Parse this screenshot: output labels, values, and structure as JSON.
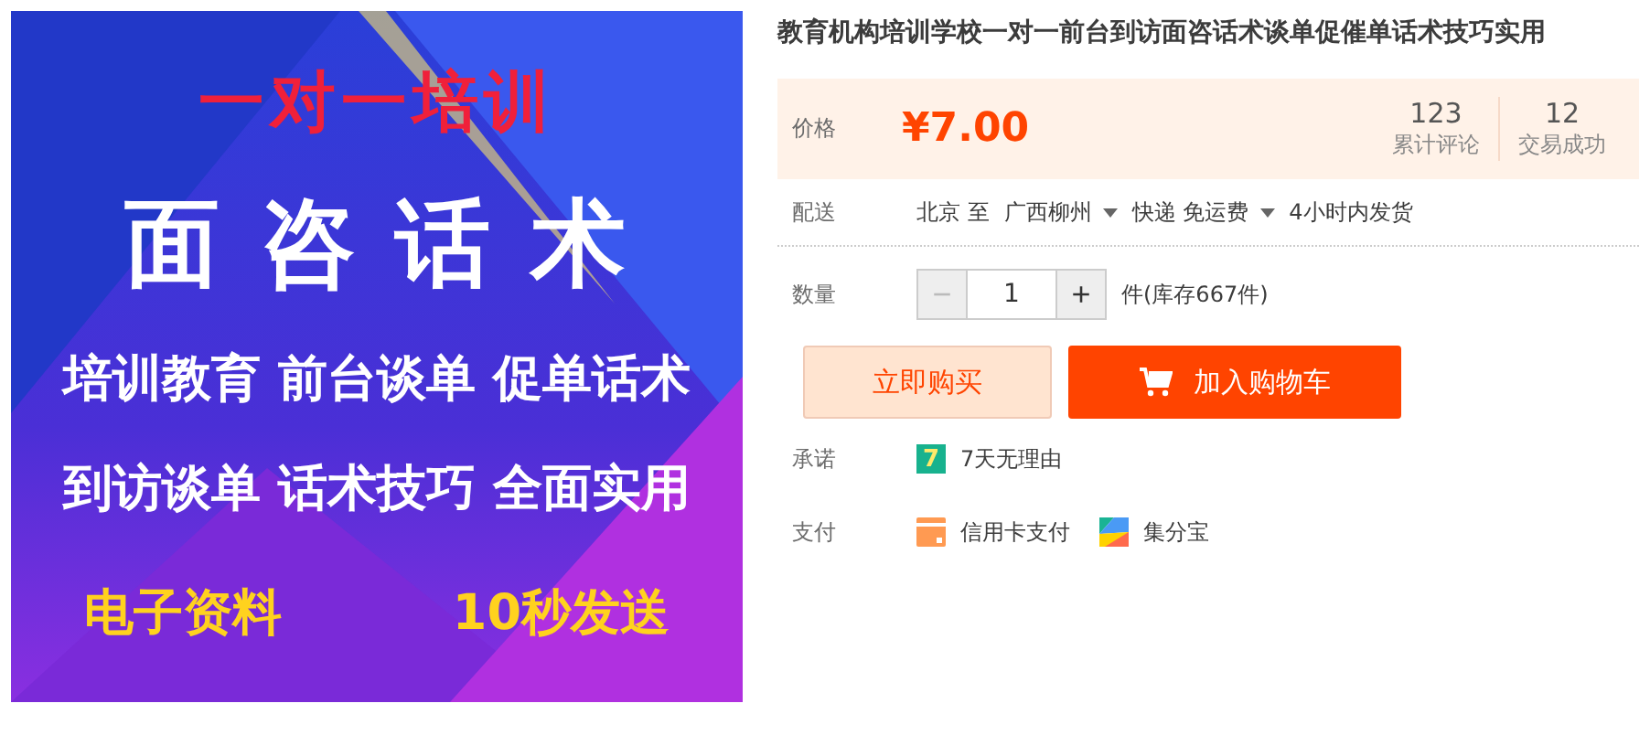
{
  "banner": {
    "headline": "一对一培训",
    "title": "面 咨 话 术",
    "lines": [
      "培训教育 前台谈单 促单话术",
      "到访谈单 话术技巧 全面实用"
    ],
    "footer": [
      "电子资料",
      "10秒发送"
    ]
  },
  "product": {
    "title": "教育机构培训学校一对一前台到访面咨话术谈单促催单话术技巧实用"
  },
  "price": {
    "label": "价格",
    "value": "¥7.00",
    "stats": [
      {
        "count": "123",
        "label": "累计评论"
      },
      {
        "count": "12",
        "label": "交易成功"
      }
    ]
  },
  "shipping": {
    "label": "配送",
    "from": "北京 至",
    "to": "广西柳州",
    "method": "快递 免运费",
    "time": "4小时内发货"
  },
  "quantity": {
    "label": "数量",
    "minus": "−",
    "value": "1",
    "plus": "+",
    "stock": "件(库存667件)"
  },
  "buttons": [
    {
      "kind": "buy",
      "label": "立即购买"
    },
    {
      "kind": "cart",
      "label": "加入购物车"
    }
  ],
  "promise": {
    "label": "承诺",
    "badge": "7",
    "text": "7天无理由"
  },
  "payment": {
    "label": "支付",
    "methods": [
      {
        "kind": "card",
        "label": "信用卡支付"
      },
      {
        "kind": "points",
        "label": "集分宝"
      }
    ]
  }
}
